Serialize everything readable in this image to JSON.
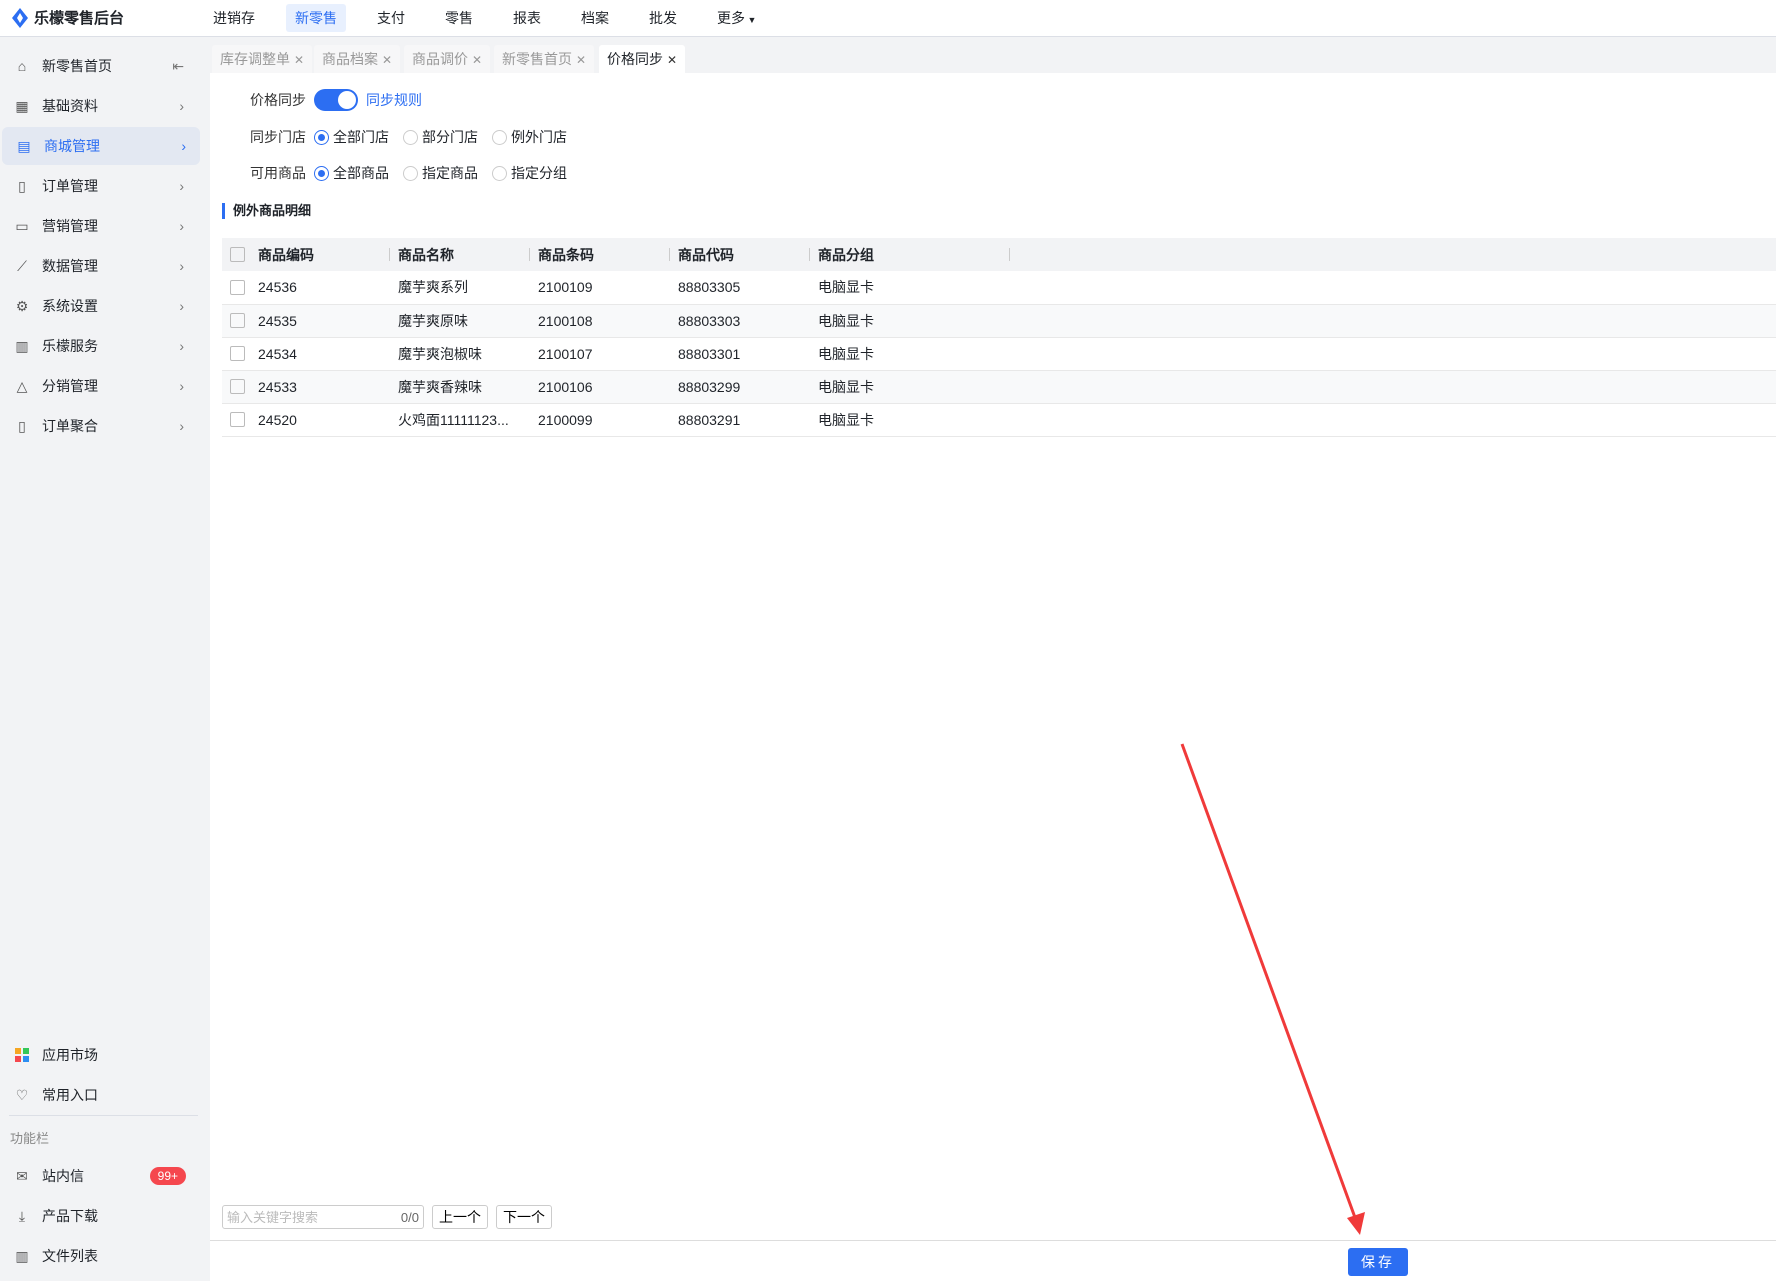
{
  "app": {
    "title": "乐檬零售后台"
  },
  "topnav": [
    "进销存",
    "新零售",
    "支付",
    "零售",
    "报表",
    "档案",
    "批发",
    "更多"
  ],
  "sidebar": {
    "items": [
      "新零售首页",
      "基础资料",
      "商城管理",
      "订单管理",
      "营销管理",
      "数据管理",
      "系统设置",
      "乐檬服务",
      "分销管理",
      "订单聚合"
    ],
    "bottom": [
      "应用市场",
      "常用入口"
    ],
    "section": "功能栏",
    "tools": [
      "站内信",
      "产品下载",
      "文件列表"
    ],
    "badge": "99+"
  },
  "tabs": [
    "库存调整单",
    "商品档案",
    "商品调价",
    "新零售首页",
    "价格同步"
  ],
  "form": {
    "price_sync_label": "价格同步",
    "sync_rule_link": "同步规则",
    "store_label": "同步门店",
    "store_options": [
      "全部门店",
      "部分门店",
      "例外门店"
    ],
    "goods_label": "可用商品",
    "goods_options": [
      "全部商品",
      "指定商品",
      "指定分组"
    ]
  },
  "section_title": "例外商品明细",
  "table": {
    "headers": [
      "商品编码",
      "商品名称",
      "商品条码",
      "商品代码",
      "商品分组"
    ],
    "rows": [
      [
        "24536",
        "魔芋爽系列",
        "2100109",
        "88803305",
        "电脑显卡"
      ],
      [
        "24535",
        "魔芋爽原味",
        "2100108",
        "88803303",
        "电脑显卡"
      ],
      [
        "24534",
        "魔芋爽泡椒味",
        "2100107",
        "88803301",
        "电脑显卡"
      ],
      [
        "24533",
        "魔芋爽香辣味",
        "2100106",
        "88803299",
        "电脑显卡"
      ],
      [
        "24520",
        "火鸡面11111123...",
        "2100099",
        "88803291",
        "电脑显卡"
      ]
    ]
  },
  "search": {
    "placeholder": "输入关键字搜索",
    "count": "0/0",
    "prev": "上一个",
    "next": "下一个"
  },
  "save": "保存",
  "colors": {
    "accent": "#2c6ef2",
    "badge": "#f5474e",
    "arrow": "#f03a3a"
  }
}
